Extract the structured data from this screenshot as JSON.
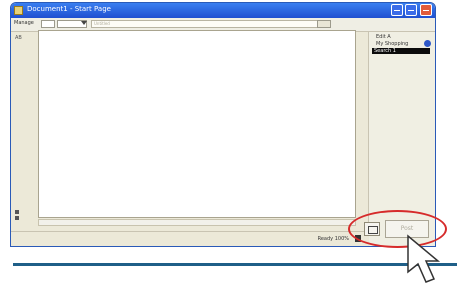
{
  "window": {
    "title": "Document1 - Start Page"
  },
  "toolbar": {
    "label": "Manage",
    "address_placeholder": "Untitled"
  },
  "left": {
    "tiny_label": "AB"
  },
  "right_panel": {
    "line1": "Edit A",
    "line2": "My Shopping",
    "select_value": "Search 1"
  },
  "status": {
    "text": "Ready 100%"
  },
  "buttons": {
    "send_label": "Post"
  },
  "colors": {
    "accent": "#2a5ab8",
    "highlight": "#d62b2b",
    "separator": "#1f5f88"
  }
}
